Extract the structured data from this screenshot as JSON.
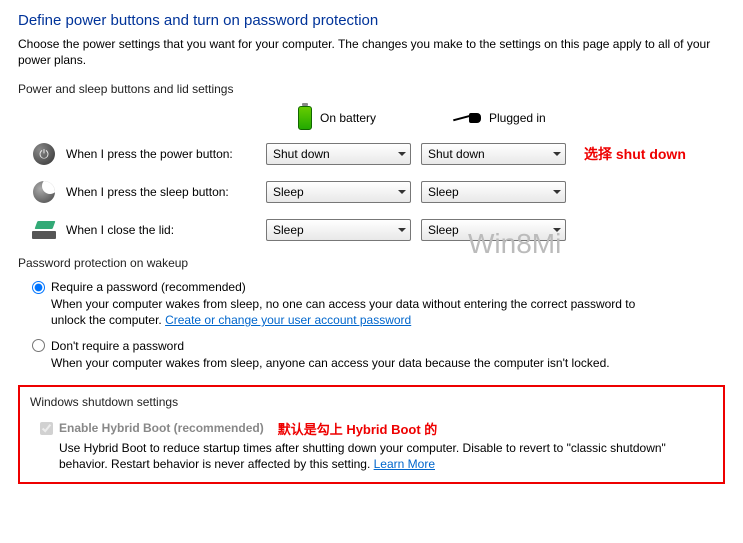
{
  "header": {
    "title": "Define power buttons and turn on password protection",
    "description": "Choose the power settings that you want for your computer. The changes you make to the settings on this page apply to all of your power plans."
  },
  "section1": {
    "label": "Power and sleep buttons and lid settings",
    "columns": {
      "battery": "On battery",
      "plugged": "Plugged in"
    },
    "rows": {
      "power_button": {
        "label": "When I press the power button:",
        "battery_value": "Shut down",
        "plugged_value": "Shut down"
      },
      "sleep_button": {
        "label": "When I press the sleep button:",
        "battery_value": "Sleep",
        "plugged_value": "Sleep"
      },
      "lid": {
        "label": "When I close the lid:",
        "battery_value": "Sleep",
        "plugged_value": "Sleep"
      }
    },
    "annotation": "选择 shut down"
  },
  "section2": {
    "label": "Password protection on wakeup",
    "option_require": {
      "label": "Require a password (recommended)",
      "desc_part1": "When your computer wakes from sleep, no one can access your data without entering the correct password to unlock the computer. ",
      "link": "Create or change your user account password"
    },
    "option_dont": {
      "label": "Don't require a password",
      "desc": "When your computer wakes from sleep, anyone can access your data because the computer isn't locked."
    }
  },
  "section3": {
    "label": "Windows shutdown settings",
    "checkbox": {
      "label": "Enable Hybrid Boot (recommended)",
      "annotation": "默认是勾上 Hybrid Boot 的",
      "desc_part1": "Use Hybrid Boot to reduce startup times after shutting down your computer. Disable to revert to \"classic shutdown\" behavior. Restart behavior is never affected by this setting. ",
      "link": "Learn More"
    }
  },
  "watermark": "Win8Mi"
}
